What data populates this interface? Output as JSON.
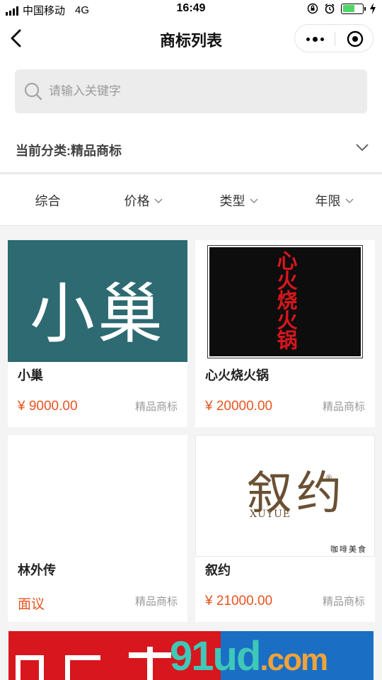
{
  "status_bar": {
    "carrier": "中国移动",
    "network": "4G",
    "time": "16:49"
  },
  "nav": {
    "title": "商标列表"
  },
  "search": {
    "placeholder": "请输入关键字",
    "value": ""
  },
  "category": {
    "label": "当前分类:精品商标"
  },
  "filters": [
    {
      "label": "综合",
      "has_arrow": false
    },
    {
      "label": "价格",
      "has_arrow": true
    },
    {
      "label": "类型",
      "has_arrow": true
    },
    {
      "label": "年限",
      "has_arrow": true
    }
  ],
  "cards": [
    {
      "name": "小巢",
      "price": "¥ 9000.00",
      "tag": "精品商标",
      "logo_text": "小巢",
      "logo_bg": "#2d6a72"
    },
    {
      "name": "心火烧火锅",
      "price": "¥ 20000.00",
      "tag": "精品商标",
      "logo_text": "心火烧火锅",
      "logo_bg": "#0d0d0d"
    },
    {
      "name": "林外传",
      "price": "面议",
      "tag": "精品商标",
      "logo_text": "",
      "logo_bg": "#ffffff"
    },
    {
      "name": "叙约",
      "price": "¥ 21000.00",
      "tag": "精品商标",
      "logo_text": "叙约",
      "logo_sub": "XUYUE",
      "logo_caption": "咖啡美食",
      "logo_bg": "#ffffff"
    }
  ],
  "watermark": {
    "text_a": "91ud",
    "text_b": ".com"
  },
  "colors": {
    "accent_price": "#e8541e",
    "logo_brown": "#6b5033",
    "logo_red": "#d8161d"
  }
}
